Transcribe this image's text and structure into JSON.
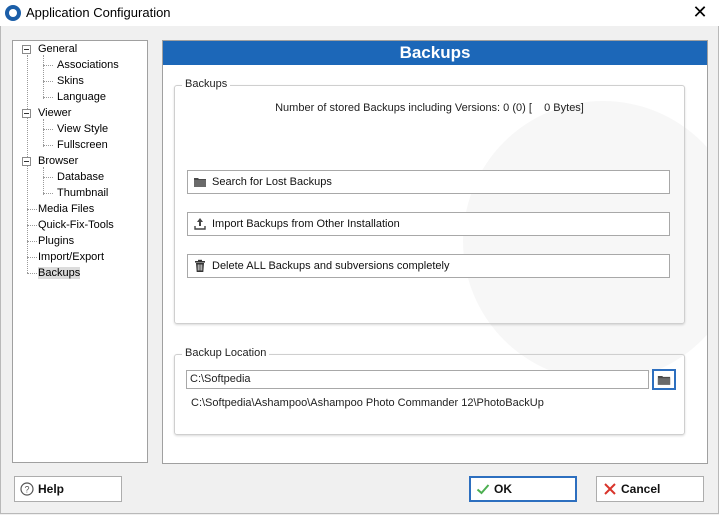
{
  "window": {
    "title": "Application Configuration",
    "close_glyph": "✕"
  },
  "tree": {
    "items": [
      {
        "label": "General",
        "level": 0,
        "expandable": true
      },
      {
        "label": "Associations",
        "level": 1
      },
      {
        "label": "Skins",
        "level": 1
      },
      {
        "label": "Language",
        "level": 1
      },
      {
        "label": "Viewer",
        "level": 0,
        "expandable": true
      },
      {
        "label": "View Style",
        "level": 1
      },
      {
        "label": "Fullscreen",
        "level": 1
      },
      {
        "label": "Browser",
        "level": 0,
        "expandable": true
      },
      {
        "label": "Database",
        "level": 1
      },
      {
        "label": "Thumbnail",
        "level": 1
      },
      {
        "label": "Media Files",
        "level": 0
      },
      {
        "label": "Quick-Fix-Tools",
        "level": 0
      },
      {
        "label": "Plugins",
        "level": 0
      },
      {
        "label": "Import/Export",
        "level": 0
      },
      {
        "label": "Backups",
        "level": 0,
        "selected": true
      }
    ]
  },
  "panel": {
    "header": "Backups",
    "backups_group": {
      "title": "Backups",
      "stored_text": "Number of stored Backups including Versions: 0 (0) [    0 Bytes]",
      "buttons": [
        {
          "label": "Search for Lost Backups",
          "icon": "folder-icon"
        },
        {
          "label": "Import Backups from Other Installation",
          "icon": "upload-icon"
        },
        {
          "label": "Delete ALL Backups and subversions completely",
          "icon": "trash-icon"
        }
      ]
    },
    "location_group": {
      "title": "Backup Location",
      "path_value": "C:\\Softpedia",
      "full_path": "C:\\Softpedia\\Ashampoo\\Ashampoo Photo Commander 12\\PhotoBackUp"
    }
  },
  "footer": {
    "help_label": "Help",
    "ok_label": "OK",
    "cancel_label": "Cancel"
  },
  "colors": {
    "header_bg": "#1c67b8",
    "ok_check": "#4caf50",
    "cancel_x": "#d9342b"
  }
}
